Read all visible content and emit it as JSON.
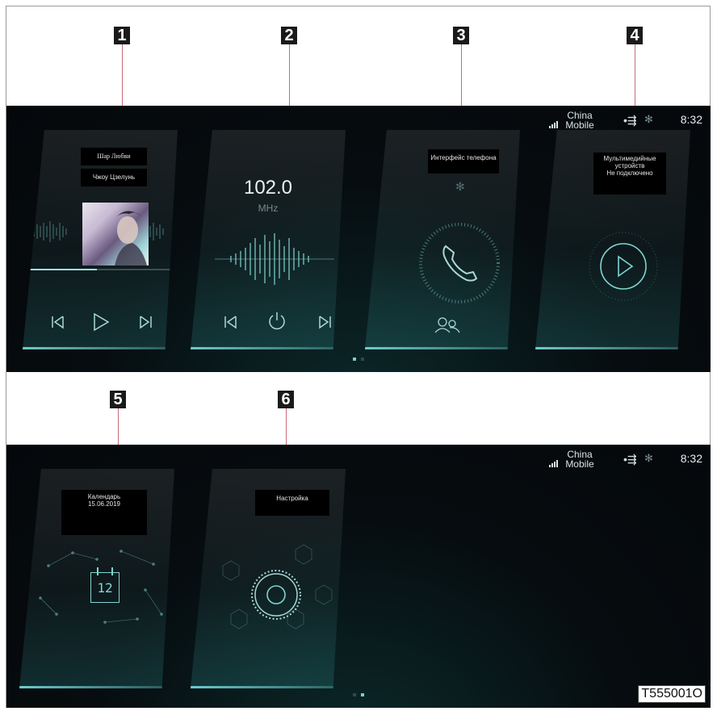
{
  "markers": [
    "1",
    "2",
    "3",
    "4",
    "5",
    "6"
  ],
  "status_bar": {
    "carrier_line1": "China",
    "carrier_line2": "Mobile",
    "time": "8:32",
    "icons": [
      "signal-icon",
      "usb-icon",
      "bluetooth-icon"
    ]
  },
  "screen1": {
    "music": {
      "song_title": "Шар Любви",
      "artist": "Чжоу Цзелунь",
      "progress": 0.45,
      "controls": [
        "previous-icon",
        "play-icon",
        "next-icon"
      ]
    },
    "radio": {
      "frequency": "102.0",
      "unit": "MHz",
      "controls": [
        "previous-icon",
        "power-icon",
        "next-icon"
      ]
    },
    "phone": {
      "title": "Интерфейс телефона",
      "icons": [
        "bluetooth-icon",
        "phone-icon",
        "contacts-icon"
      ]
    },
    "media": {
      "line1": "Мультимедийные",
      "line2": "устройств",
      "line3": "Не подключено",
      "icons": [
        "play-icon"
      ]
    },
    "page_indicator": {
      "active": 1,
      "count": 2
    }
  },
  "screen2": {
    "calendar": {
      "title": "Календарь",
      "date": "15.06.2019",
      "day": "12"
    },
    "settings": {
      "title": "Настройка"
    },
    "page_indicator": {
      "active": 2,
      "count": 2
    }
  },
  "figure_code": "T555001O",
  "colors": {
    "accent": "#7fd6d2",
    "background": "#05080b",
    "marker": "#1a1a1a",
    "leader": "#c86a78"
  }
}
